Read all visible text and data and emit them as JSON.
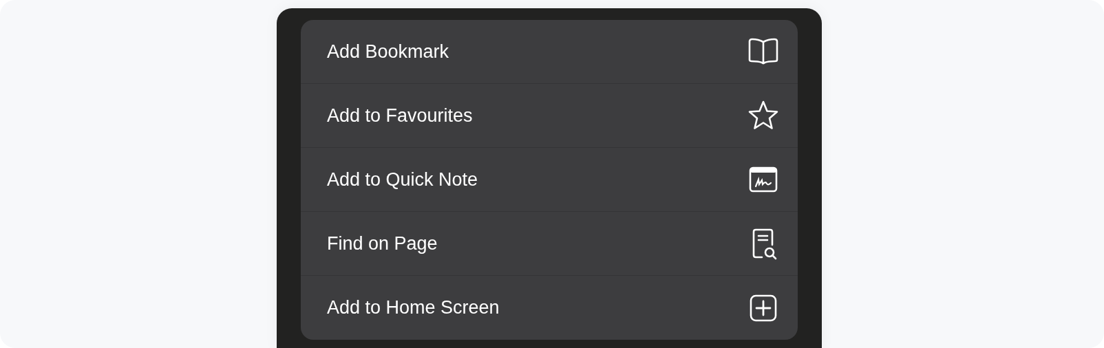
{
  "menu": {
    "items": [
      {
        "label": "Add Bookmark"
      },
      {
        "label": "Add to Favourites"
      },
      {
        "label": "Add to Quick Note"
      },
      {
        "label": "Find on Page"
      },
      {
        "label": "Add to Home Screen"
      }
    ]
  }
}
